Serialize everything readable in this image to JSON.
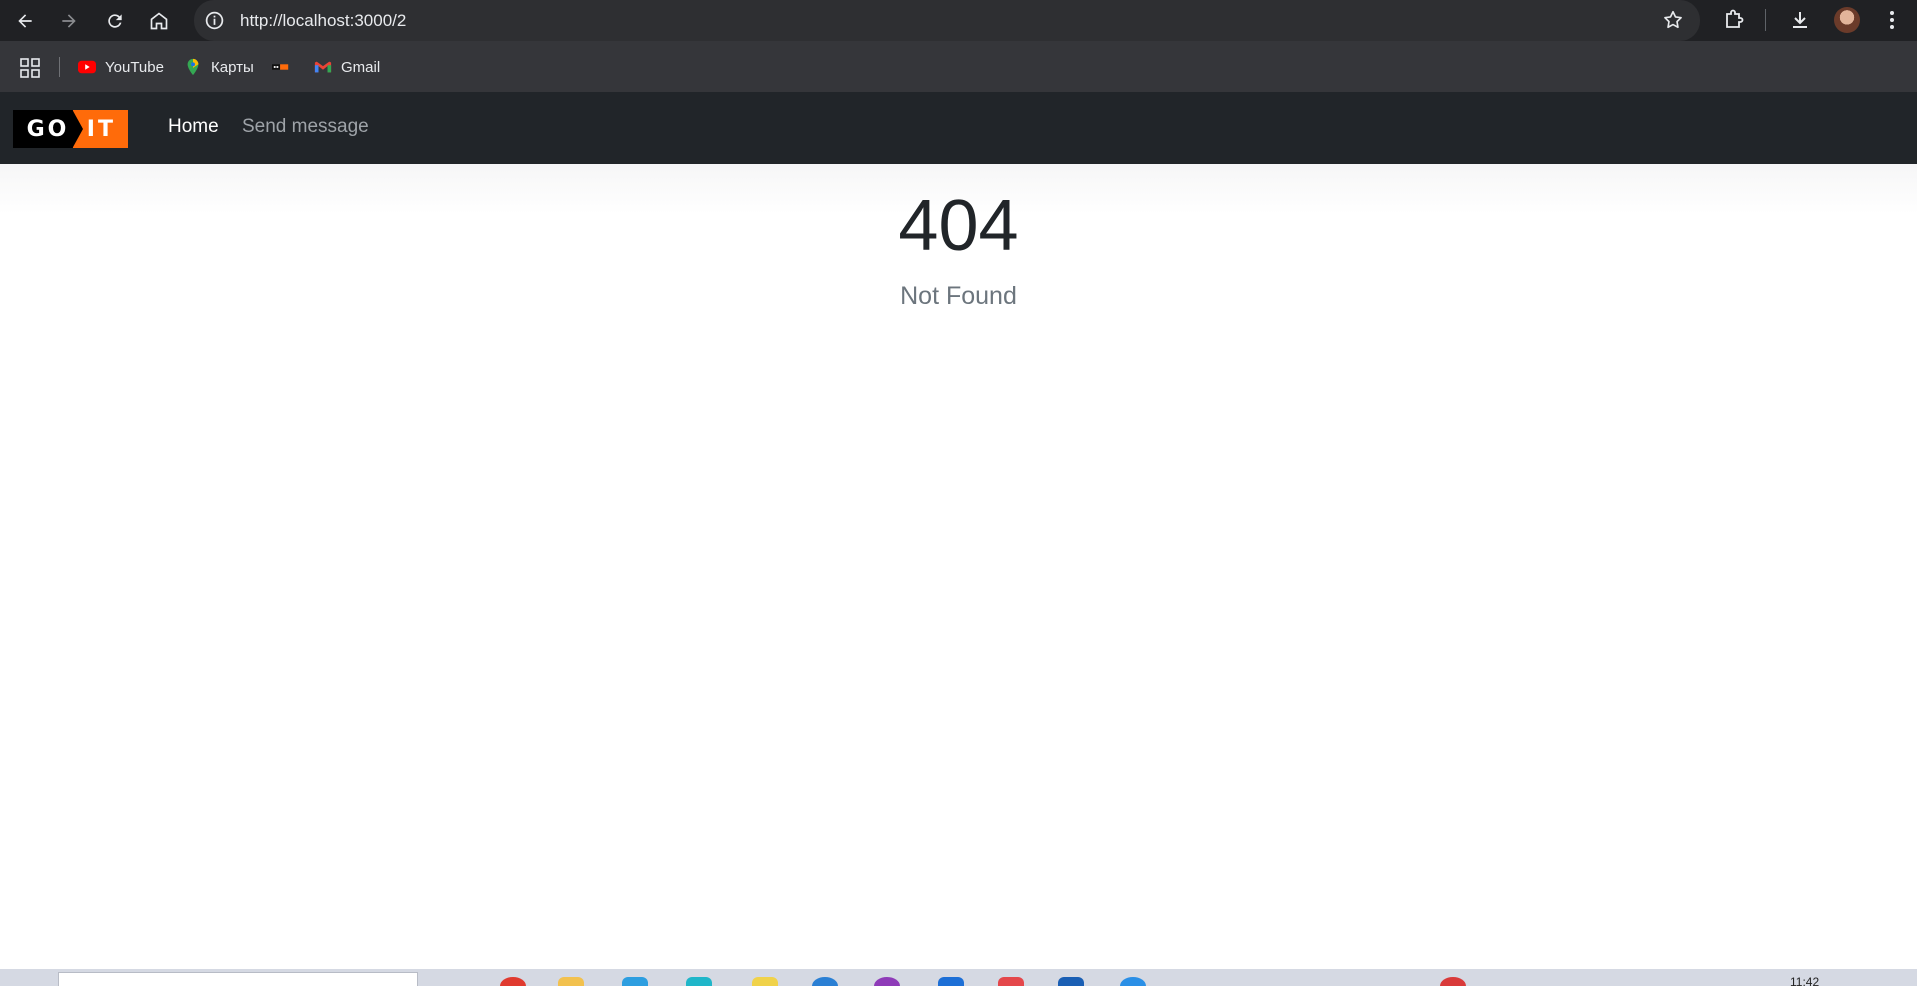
{
  "browser": {
    "url": "http://localhost:3000/2",
    "bookmarks": [
      {
        "label": "YouTube",
        "icon": "youtube-icon"
      },
      {
        "label": "Карты",
        "icon": "maps-icon"
      },
      {
        "label": "",
        "icon": "bookmark-favicon-icon"
      },
      {
        "label": "Gmail",
        "icon": "gmail-icon"
      }
    ]
  },
  "app": {
    "logo": {
      "left": "GO",
      "right": "IT",
      "accent": "#ff6b0a"
    },
    "nav": [
      {
        "label": "Home",
        "active": true
      },
      {
        "label": "Send message",
        "active": false
      }
    ]
  },
  "error": {
    "code": "404",
    "message": "Not Found"
  },
  "taskbar": {
    "clock": "11:42"
  }
}
